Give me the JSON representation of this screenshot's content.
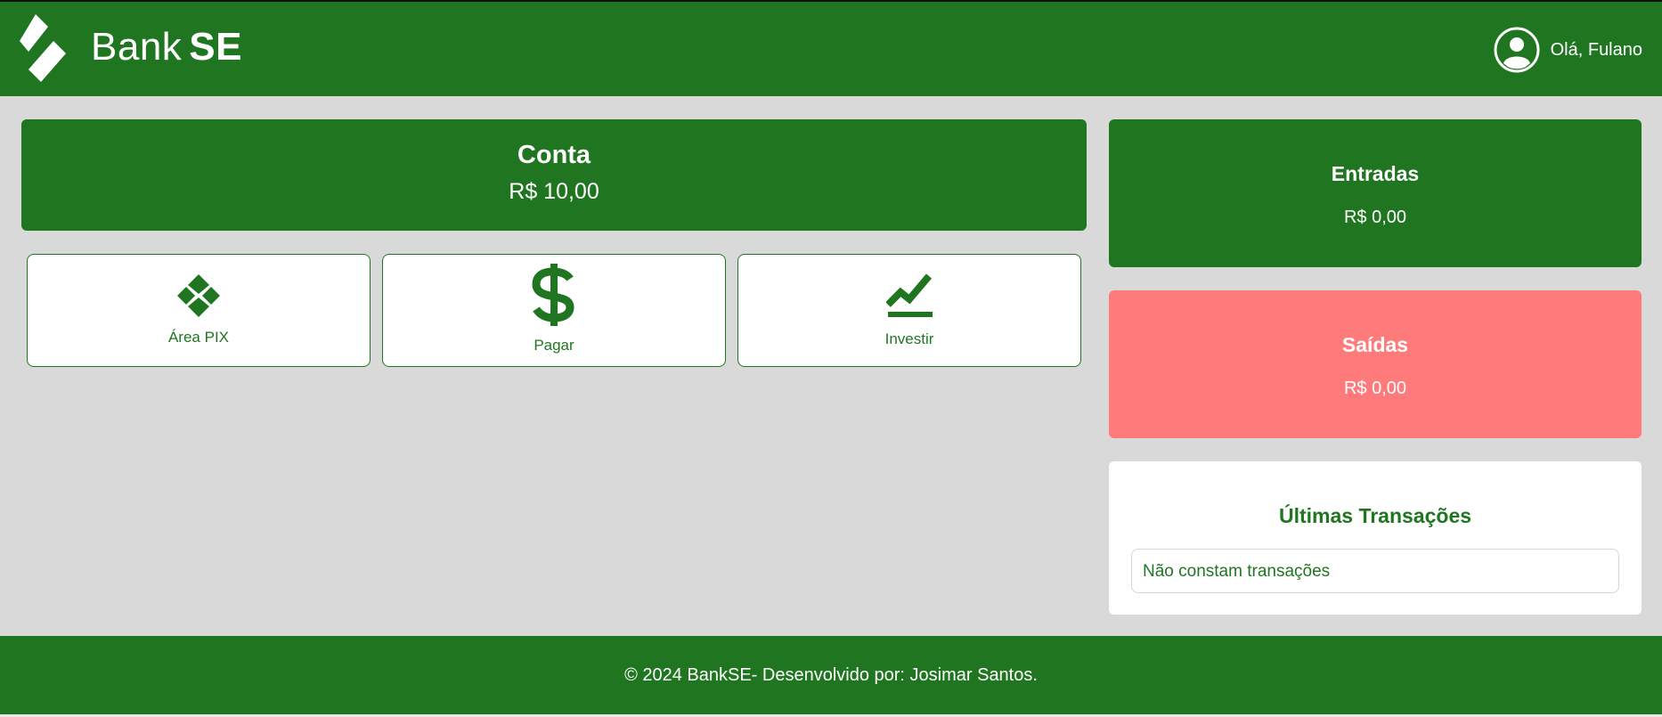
{
  "header": {
    "brand_part1": "Bank",
    "brand_part2": "SE",
    "greeting": "Olá, Fulano",
    "logo_icon": "diamond-logo-icon",
    "user_icon": "user-circle-icon"
  },
  "account": {
    "title": "Conta",
    "balance": "R$ 10,00"
  },
  "actions": [
    {
      "label": "Área PIX",
      "icon": "pix-icon"
    },
    {
      "label": "Pagar",
      "icon": "dollar-icon"
    },
    {
      "label": "Investir",
      "icon": "trend-chart-icon"
    }
  ],
  "summary": {
    "income_title": "Entradas",
    "income_value": "R$ 0,00",
    "expense_title": "Saídas",
    "expense_value": "R$ 0,00"
  },
  "transactions": {
    "title": "Últimas Transações",
    "empty_text": "Não constam transações"
  },
  "footer": {
    "text": "© 2024 BankSE- Desenvolvido por: Josimar Santos."
  },
  "colors": {
    "primary_green": "#207620",
    "expense_red": "#ff7b7b",
    "background_gray": "#d9d9d9"
  }
}
